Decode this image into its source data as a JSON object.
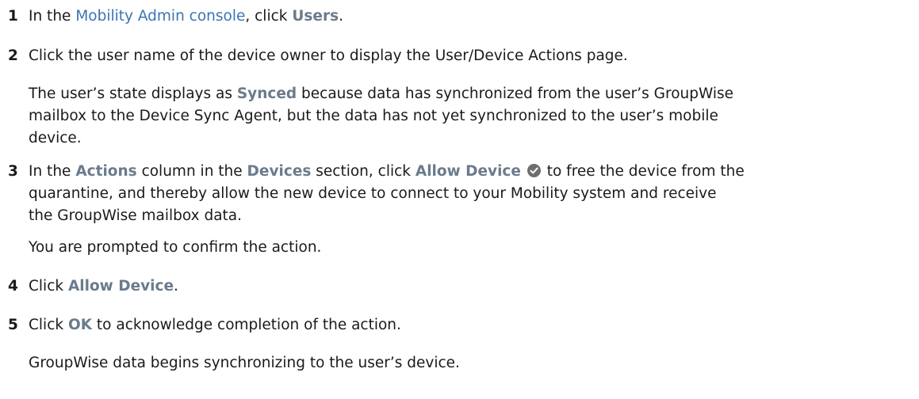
{
  "steps": [
    {
      "num": "1",
      "pre": "In the ",
      "link": "Mobility Admin console",
      "mid": ", click ",
      "ui": "Users",
      "post": "."
    },
    {
      "num": "2",
      "text": "Click the user name of the device owner to display the User/Device Actions page."
    },
    {
      "num": "3",
      "pre": "In the ",
      "ui1": "Actions",
      "mid1": " column in the ",
      "ui2": "Devices",
      "mid2": " section, click ",
      "ui3": "Allow Device",
      "line1_post": " to free the device from the",
      "line2": "quarantine, and thereby allow the new device to connect to your Mobility system and receive",
      "line3": "the GroupWise mailbox data."
    },
    {
      "num": "4",
      "pre": "Click ",
      "ui": "Allow Device",
      "post": "."
    },
    {
      "num": "5",
      "pre": "Click ",
      "ui": "OK",
      "post": " to acknowledge completion of the action."
    }
  ],
  "notes": {
    "synced": {
      "pre": "The user’s state displays as ",
      "ui": "Synced",
      "line1_post": " because data has synchronized from the user’s GroupWise",
      "line2": "mailbox to the Device Sync Agent, but the data has not yet synchronized to the user’s mobile",
      "line3": "device."
    },
    "prompt": "You are prompted to confirm the action.",
    "result": "GroupWise data begins synchronizing to the user’s device."
  },
  "icons": {
    "allow_device": "check-circle-icon"
  }
}
